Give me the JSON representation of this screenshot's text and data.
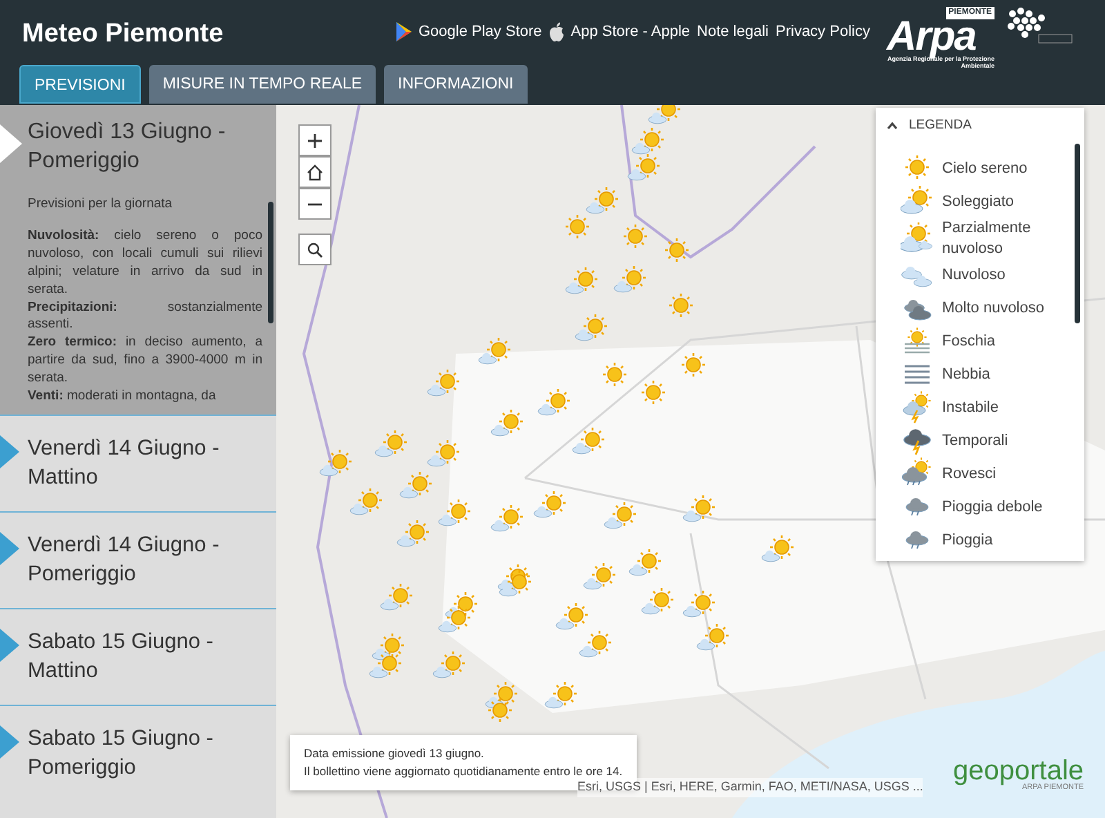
{
  "header": {
    "title": "Meteo Piemonte",
    "links": [
      {
        "kind": "play",
        "label": "Google Play Store"
      },
      {
        "kind": "apple",
        "label": "App Store - Apple"
      },
      {
        "kind": "plain",
        "label": "Note legali"
      },
      {
        "kind": "plain",
        "label": "Privacy Policy"
      }
    ],
    "logo": {
      "name": "Arpa",
      "region": "PIEMONTE",
      "tagline": "Agenzia Regionale per la Protezione Ambientale"
    }
  },
  "tabs": [
    {
      "label": "PREVISIONI",
      "selected": true
    },
    {
      "label": "MISURE IN TEMPO REALE",
      "selected": false
    },
    {
      "label": "INFORMAZIONI",
      "selected": false
    }
  ],
  "forecasts": [
    {
      "title": "Giovedì 13 Giugno - Pomeriggio",
      "expanded": true,
      "heading": "Previsioni per la giornata",
      "paragraphs": [
        "**Nuvolosità:** cielo sereno o poco nuvoloso, con locali cumuli sui rilievi alpini; velature in arrivo da sud in serata.",
        "**Precipitazioni:** sostanzialmente assenti.",
        "**Zero termico:** in deciso aumento, a partire da sud, fino a 3900-4000 m in serata.",
        "**Venti:** moderati in montagna, da"
      ]
    },
    {
      "title": "Venerdì 14 Giugno - Mattino",
      "expanded": false
    },
    {
      "title": "Venerdì 14 Giugno - Pomeriggio",
      "expanded": false
    },
    {
      "title": "Sabato 15 Giugno - Mattino",
      "expanded": false
    },
    {
      "title": "Sabato 15 Giugno - Pomeriggio",
      "expanded": false
    }
  ],
  "legend": {
    "title": "LEGENDA",
    "expanded": true,
    "items": [
      {
        "kind": "sun",
        "label": "Cielo sereno"
      },
      {
        "kind": "sun-cloud",
        "label": "Soleggiato"
      },
      {
        "kind": "partly",
        "label": "Parzialmente nuvoloso"
      },
      {
        "kind": "cloud",
        "label": "Nuvoloso"
      },
      {
        "kind": "dark-cloud",
        "label": "Molto nuvoloso"
      },
      {
        "kind": "haze",
        "label": "Foschia"
      },
      {
        "kind": "fog",
        "label": "Nebbia"
      },
      {
        "kind": "unstable",
        "label": "Instabile"
      },
      {
        "kind": "storm",
        "label": "Temporali"
      },
      {
        "kind": "showers",
        "label": "Rovesci"
      },
      {
        "kind": "rain",
        "label": "Pioggia debole"
      },
      {
        "kind": "rain",
        "label": "Pioggia"
      }
    ]
  },
  "info": [
    "Data emissione giovedì 13 giugno.",
    "Il bollettino viene aggiornato quotidianamente entro le ore 14."
  ],
  "attribution": "Esri, USGS | Esri, HERE, Garmin, FAO, METI/NASA, USGS ...",
  "geoportale": {
    "name": "geoportale",
    "sub": "ARPA PIEMONTE"
  }
}
